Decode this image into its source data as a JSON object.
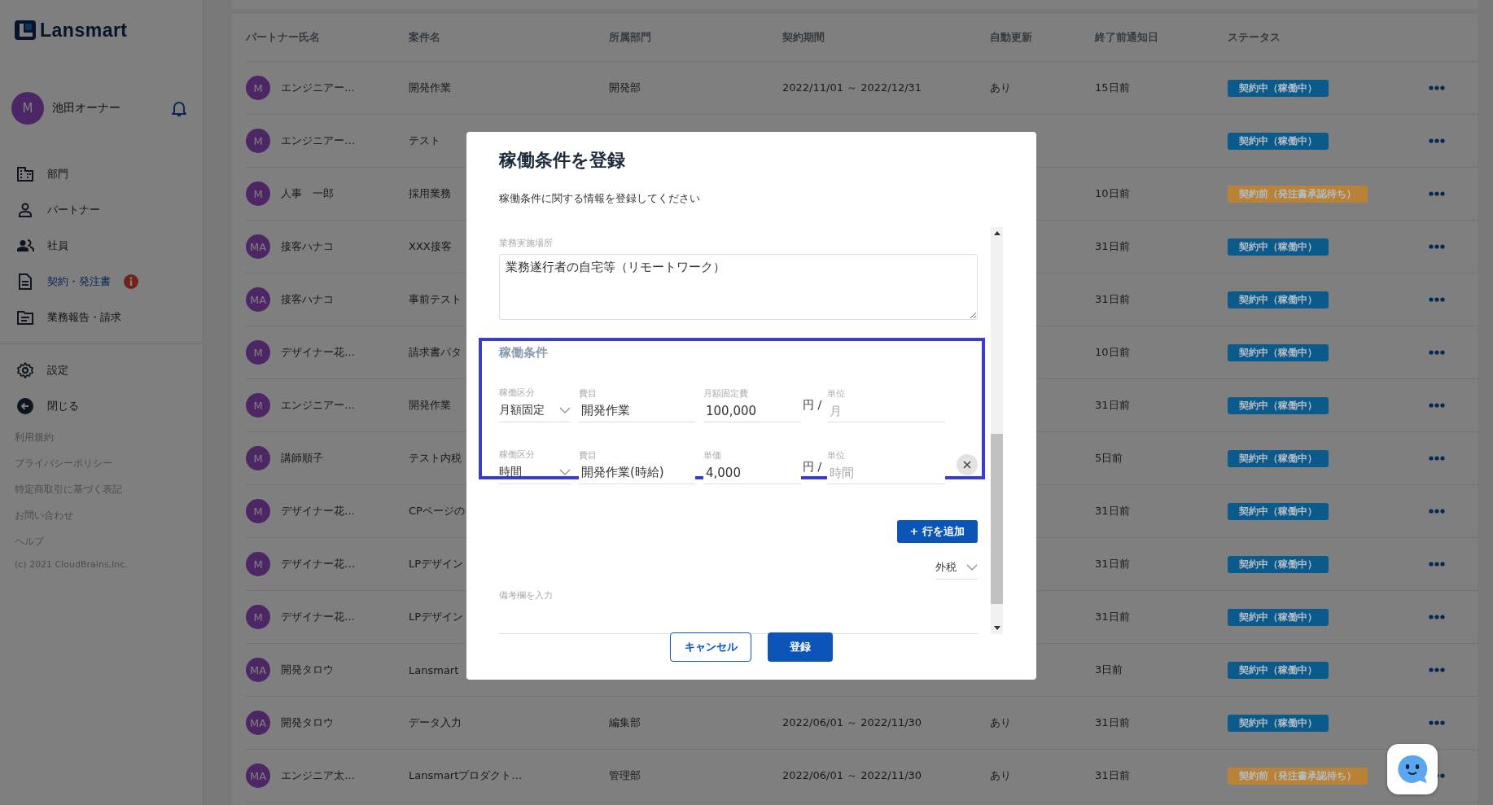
{
  "sidebar": {
    "logo": "Lansmart",
    "user": {
      "initial": "M",
      "name": "池田オーナー"
    },
    "nav": [
      {
        "label": "部門",
        "selected": false,
        "alert": false
      },
      {
        "label": "パートナー",
        "selected": false,
        "alert": false
      },
      {
        "label": "社員",
        "selected": false,
        "alert": false
      },
      {
        "label": "契約・発注書",
        "selected": true,
        "alert": true
      },
      {
        "label": "業務報告・請求",
        "selected": false,
        "alert": false
      }
    ],
    "actions": [
      {
        "label": "設定"
      },
      {
        "label": "閉じる"
      }
    ],
    "links": [
      "利用規約",
      "プライバシーポリシー",
      "特定商取引に基づく表記",
      "お問い合わせ",
      "ヘルプ"
    ],
    "copyright": "(c) 2021 CloudBrains,Inc."
  },
  "table": {
    "columns": [
      "パートナー氏名",
      "案件名",
      "所属部門",
      "契約期間",
      "自動更新",
      "終了前通知日",
      "ステータス"
    ],
    "rows": [
      {
        "initials": "M",
        "partner": "エンジニアー…",
        "case": "開発作業",
        "department": "開発部",
        "period": "2022/11/01 ～ 2022/12/31",
        "auto_renew": "あり",
        "notice": "15日前",
        "status": "契約中（稼働中）",
        "color": "#0b5a8c"
      },
      {
        "initials": "M",
        "partner": "エンジニアー…",
        "case": "テスト",
        "status": "契約中（稼働中）",
        "color": "#0b5a8c"
      },
      {
        "initials": "M",
        "partner": "人事　一郎",
        "case": "採用業務",
        "notice": "10日前",
        "status": "契約前（発注書承認待ち）",
        "color": "#b98236"
      },
      {
        "initials": "MA",
        "partner": "接客ハナコ",
        "case": "XXX接客",
        "notice": "31日前",
        "status": "契約中（稼働中）",
        "color": "#0b5a8c"
      },
      {
        "initials": "MA",
        "partner": "接客ハナコ",
        "case": "事前テスト",
        "notice": "31日前",
        "status": "契約中（稼働中）",
        "color": "#0b5a8c"
      },
      {
        "initials": "M",
        "partner": "デザイナー花…",
        "case": "請求書パタ",
        "notice": "10日前",
        "status": "契約中（稼働中）",
        "color": "#0b5a8c"
      },
      {
        "initials": "M",
        "partner": "エンジニアー…",
        "case": "開発作業",
        "notice": "31日前",
        "status": "契約中（稼働中）",
        "color": "#0b5a8c"
      },
      {
        "initials": "M",
        "partner": "講師順子",
        "case": "テスト内税",
        "notice": "5日前",
        "status": "契約中（稼働中）",
        "color": "#0b5a8c"
      },
      {
        "initials": "M",
        "partner": "デザイナー花…",
        "case": "CPページの",
        "notice": "31日前",
        "status": "契約中（稼働中）",
        "color": "#0b5a8c"
      },
      {
        "initials": "M",
        "partner": "デザイナー花…",
        "case": "LPデザイン",
        "notice": "31日前",
        "status": "契約中（稼働中）",
        "color": "#0b5a8c"
      },
      {
        "initials": "M",
        "partner": "デザイナー花…",
        "case": "LPデザイン",
        "notice": "31日前",
        "status": "契約中（稼働中）",
        "color": "#0b5a8c"
      },
      {
        "initials": "MA",
        "partner": "開発タロウ",
        "case": "Lansmart",
        "notice": "3日前",
        "status": "契約中（稼働中）",
        "color": "#0b5a8c"
      },
      {
        "initials": "MA",
        "partner": "開発タロウ",
        "case": "データ入力",
        "department": "編集部",
        "period": "2022/06/01 ～ 2022/11/30",
        "auto_renew": "あり",
        "notice": "31日前",
        "status": "契約中（稼働中）",
        "color": "#0b5a8c"
      },
      {
        "initials": "MA",
        "partner": "エンジニア太…",
        "case": "Lansmartプロダクト…",
        "department": "管理部",
        "period": "2022/06/01 ～ 2022/11/30",
        "auto_renew": "あり",
        "notice": "31日前",
        "status": "契約前（発注書承認待ち）",
        "color": "#b98236"
      }
    ]
  },
  "modal": {
    "title": "稼働条件を登録",
    "subtitle": "稼働条件に関する情報を登録してください",
    "location": {
      "label": "業務実施場所",
      "value": "業務遂行者の自宅等（リモートワーク）"
    },
    "conditions": {
      "title": "稼働条件",
      "rows": [
        {
          "type": {
            "label": "稼働区分",
            "value": "月額固定"
          },
          "item": {
            "label": "費目",
            "value": "開発作業"
          },
          "amount": {
            "label": "月額固定費",
            "value": "100,000"
          },
          "currency": "円 /",
          "unit": {
            "label": "単位",
            "placeholder": "月"
          },
          "removable": false
        },
        {
          "type": {
            "label": "稼働区分",
            "value": "時間"
          },
          "item": {
            "label": "費目",
            "value": "開発作業(時給)"
          },
          "amount": {
            "label": "単価",
            "value": "4,000"
          },
          "currency": "円 /",
          "unit": {
            "label": "単位",
            "placeholder": "時間"
          },
          "removable": true
        }
      ]
    },
    "add_row": "+ 行を追加",
    "tax": "外税",
    "notes": {
      "label": "備考欄を入力"
    },
    "buttons": [
      {
        "label": "キャンセル",
        "kind": "secondary"
      },
      {
        "label": "登録",
        "kind": "primary"
      }
    ]
  }
}
